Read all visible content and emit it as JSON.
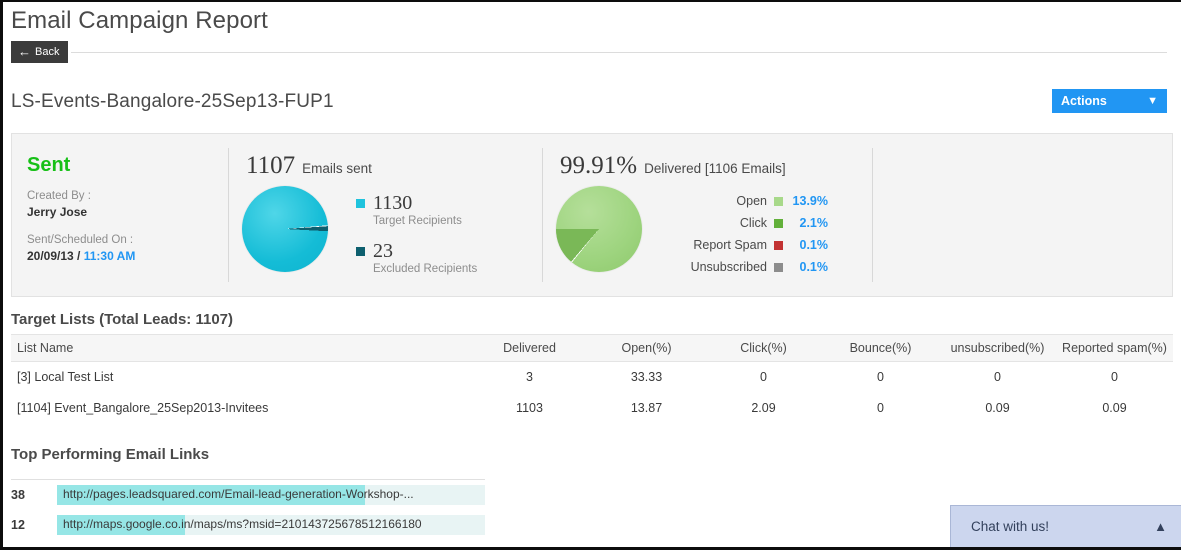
{
  "header": {
    "page_title": "Email Campaign Report",
    "back_label": "Back",
    "back_icon": "arrow-left-icon"
  },
  "campaign": {
    "name": "LS-Events-Bangalore-25Sep13-FUP1",
    "actions_label": "Actions",
    "actions_icon": "chevron-down-icon"
  },
  "summary": {
    "status": "Sent",
    "status_color": "#17c017",
    "created_by_label": "Created By :",
    "created_by_value": "Jerry Jose",
    "scheduled_label": "Sent/Scheduled On :",
    "scheduled_date": "20/09/13",
    "scheduled_sep": " / ",
    "scheduled_time": "11:30 AM",
    "sent": {
      "count": "1107",
      "caption": "Emails sent",
      "legend": [
        {
          "value": "1130",
          "label": "Target Recipients",
          "color": "#1fc3dd"
        },
        {
          "value": "23",
          "label": "Excluded Recipients",
          "color": "#0d5f6e"
        }
      ]
    },
    "delivered": {
      "percent": "99.91%",
      "caption": "Delivered [1106 Emails]",
      "legend": [
        {
          "label": "Open",
          "value": "13.9%",
          "color": "#a8d98a"
        },
        {
          "label": "Click",
          "value": "2.1%",
          "color": "#62b03a"
        },
        {
          "label": "Report Spam",
          "value": "0.1%",
          "color": "#c23232"
        },
        {
          "label": "Unsubscribed",
          "value": "0.1%",
          "color": "#8c8c8c"
        }
      ]
    }
  },
  "target_lists": {
    "title": "Target Lists (Total Leads: 1107)",
    "columns": [
      "List Name",
      "Delivered",
      "Open(%)",
      "Click(%)",
      "Bounce(%)",
      "unsubscribed(%)",
      "Reported spam(%)"
    ],
    "rows": [
      {
        "name": "[3] Local Test List",
        "delivered": "3",
        "open": "33.33",
        "click": "0",
        "bounce": "0",
        "unsubscribed": "0",
        "spam": "0"
      },
      {
        "name": "[1104] Event_Bangalore_25Sep2013-Invitees",
        "delivered": "1103",
        "open": "13.87",
        "click": "2.09",
        "bounce": "0",
        "unsubscribed": "0.09",
        "spam": "0.09"
      }
    ]
  },
  "top_links": {
    "title": "Top Performing Email Links",
    "rows": [
      {
        "count": "38",
        "url": "http://pages.leadsquared.com/Email-lead-generation-Workshop-...",
        "fill_percent": 72
      },
      {
        "count": "12",
        "url": "http://maps.google.co.in/maps/ms?msid=210143725678512166180",
        "fill_percent": 30
      }
    ]
  },
  "chat": {
    "label": "Chat with us!",
    "icon": "chevron-up-icon"
  }
}
